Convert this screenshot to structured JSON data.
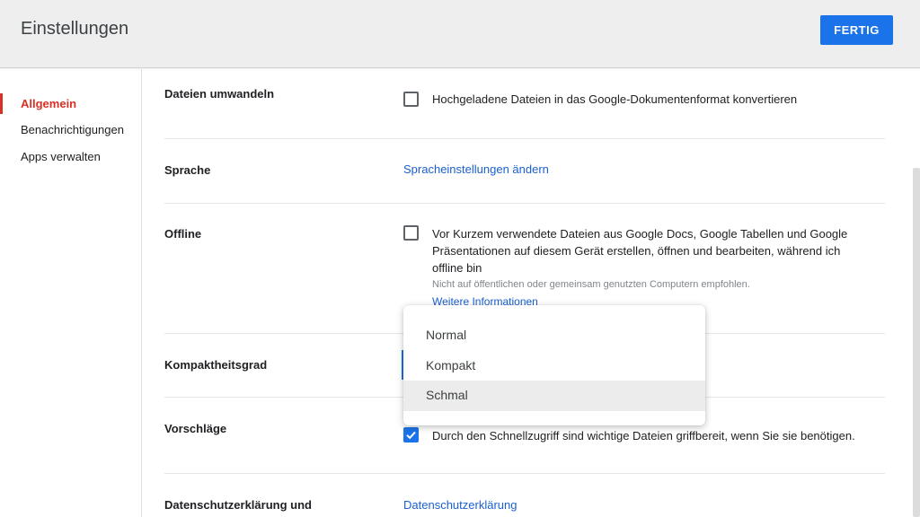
{
  "header": {
    "title": "Einstellungen",
    "done_label": "FERTIG"
  },
  "sidebar": {
    "items": [
      {
        "label": "Allgemein",
        "active": true
      },
      {
        "label": "Benachrichtigungen",
        "active": false
      },
      {
        "label": "Apps verwalten",
        "active": false
      }
    ]
  },
  "rows": {
    "convert": {
      "label": "Dateien umwandeln",
      "checkbox_text": "Hochgeladene Dateien in das Google-Dokumentenformat konvertieren",
      "checked": false
    },
    "language": {
      "label": "Sprache",
      "link": "Spracheinstellungen ändern"
    },
    "offline": {
      "label": "Offline",
      "lines": [
        "Vor Kurzem verwendete Dateien aus Google Docs, Google Tabellen und Google",
        "Präsentationen auf diesem Gerät erstellen, öffnen und bearbeiten, während ich",
        "offline bin"
      ],
      "hint": "Nicht auf öffentlichen oder gemeinsam genutzten Computern empfohlen.",
      "link": "Weitere Informationen",
      "checked": false
    },
    "density": {
      "label": "Kompaktheitsgrad",
      "options": [
        "Normal",
        "Kompakt",
        "Schmal"
      ],
      "highlighted": "Schmal"
    },
    "suggestions": {
      "label": "Vorschläge",
      "checkbox_text": "Durch den Schnellzugriff sind wichtige Dateien griffbereit, wenn Sie sie benötigen.",
      "checked": true
    },
    "privacy": {
      "label": "Datenschutzerklärung und",
      "link": "Datenschutzerklärung"
    }
  },
  "colors": {
    "accent": "#1a73e8",
    "active_nav": "#d93025",
    "header_bg": "#eeeeee"
  }
}
